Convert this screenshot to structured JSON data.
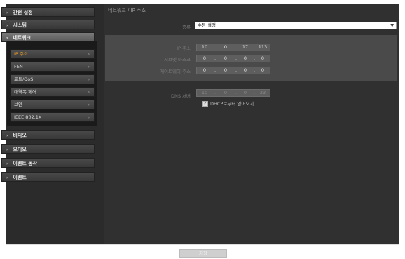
{
  "sidebar": {
    "items": [
      {
        "label": "간편 설정"
      },
      {
        "label": "시스템"
      },
      {
        "label": "네트워크"
      },
      {
        "label": "비디오"
      },
      {
        "label": "오디오"
      },
      {
        "label": "이벤트 동작"
      },
      {
        "label": "이벤트"
      }
    ],
    "subitems": [
      {
        "label": "IP 주소"
      },
      {
        "label": "FEN"
      },
      {
        "label": "포트/QoS"
      },
      {
        "label": "대역폭 제어"
      },
      {
        "label": "보안"
      },
      {
        "label": "IEEE 802.1X"
      }
    ],
    "arrow": "›",
    "expanded_arrow": "▾"
  },
  "main": {
    "title": "네트워크 / IP 주소",
    "type_label": "종류",
    "type_value": "수동 설정",
    "fields": [
      {
        "label": "IP 주소",
        "values": [
          "10",
          "0",
          "17",
          "113"
        ]
      },
      {
        "label": "서브넷 마스크",
        "values": [
          "0",
          "0",
          "0",
          "0"
        ]
      },
      {
        "label": "게이트웨이 주소",
        "values": [
          "0",
          "0",
          "0",
          "0"
        ]
      }
    ],
    "dns": {
      "label": "DNS 서버",
      "values": [
        "10",
        "0",
        "0",
        "23"
      ]
    },
    "dhcp_checkbox_label": "DHCP로부터 얻어오기",
    "dhcp_checked": true,
    "dot": "."
  },
  "footer": {
    "apply_label": "저장"
  },
  "colors": {
    "active_sub": "#f0a020",
    "background": "#303030"
  }
}
